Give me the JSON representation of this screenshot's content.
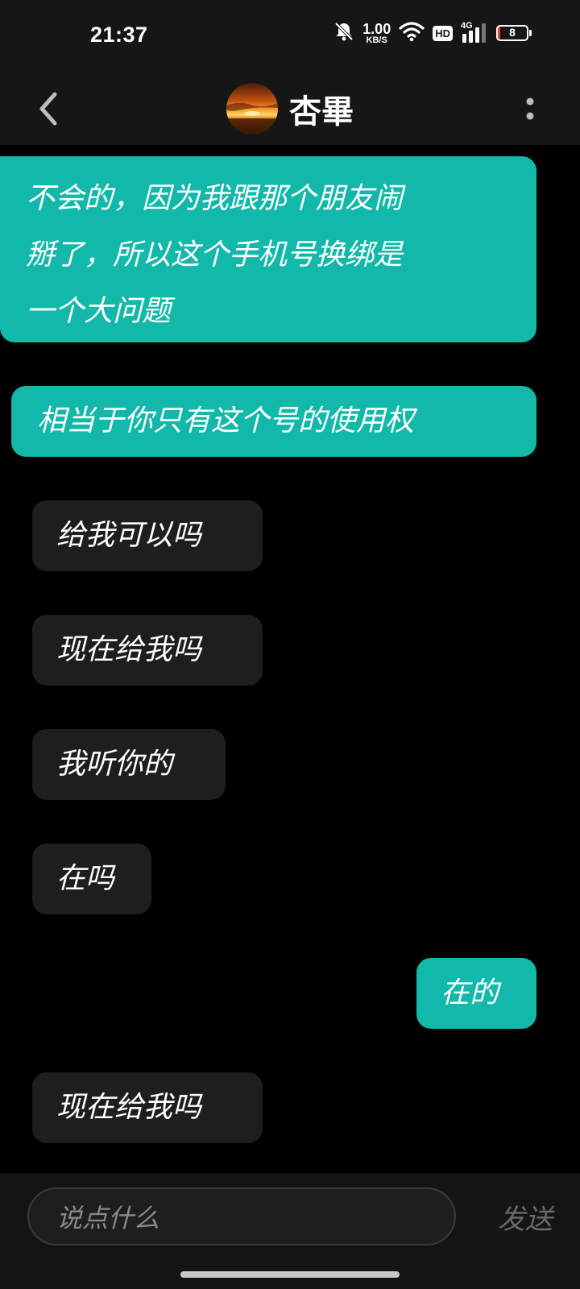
{
  "status_bar": {
    "time": "21:37",
    "net_speed_value": "1.00",
    "net_speed_unit": "KB/S",
    "hd_label": "HD",
    "network_gen": "4G",
    "battery_level": "8",
    "icons": [
      "mute-bell-icon",
      "wifi-icon",
      "hd-icon",
      "signal-icon",
      "battery-icon"
    ]
  },
  "header": {
    "title": "杏畢",
    "back_icon": "chevron-left-icon",
    "more_icon": "vertical-dots-icon"
  },
  "messages": [
    {
      "direction": "out",
      "lines": [
        "不会的，因为我跟那个朋友闹",
        "掰了，所以这个手机号换绑是",
        "一个大问题"
      ]
    },
    {
      "direction": "out",
      "lines": [
        "相当于你只有这个号的使用权"
      ]
    },
    {
      "direction": "in",
      "lines": [
        "给我可以吗"
      ]
    },
    {
      "direction": "in",
      "lines": [
        "现在给我吗"
      ]
    },
    {
      "direction": "in",
      "lines": [
        "我听你的"
      ]
    },
    {
      "direction": "in",
      "lines": [
        "在吗"
      ]
    },
    {
      "direction": "out",
      "lines": [
        "在的"
      ]
    },
    {
      "direction": "in",
      "lines": [
        "现在给我吗"
      ]
    }
  ],
  "composer": {
    "placeholder": "说点什么",
    "send_label": "发送"
  },
  "colors": {
    "outgoing_bubble": "#12b8aa",
    "incoming_bubble": "#1e1e1e",
    "background": "#000000",
    "bar": "#161616"
  }
}
